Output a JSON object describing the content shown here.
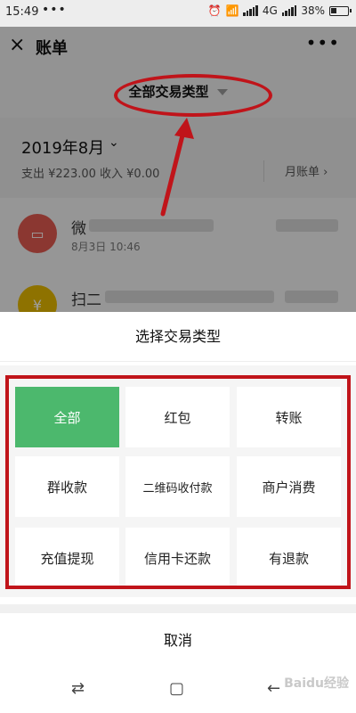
{
  "status_bar": {
    "time": "15:49",
    "dots": "•••",
    "network": "4G",
    "battery": "38%"
  },
  "nav": {
    "close_icon": "×",
    "title": "账单",
    "more_icon": "•••"
  },
  "filter": {
    "label": "全部交易类型"
  },
  "month": {
    "title": "2019年8月",
    "chevron": "⌄",
    "summary": "支出 ¥223.00  收入 ¥0.00",
    "link": "月账单 ›"
  },
  "transactions": [
    {
      "title": "微",
      "date": "8月3日 10:46",
      "icon": "red-packet-icon"
    },
    {
      "title": "扫二",
      "date": "",
      "icon": "money-bag-icon"
    }
  ],
  "sheet": {
    "title": "选择交易类型",
    "options": [
      "全部",
      "红包",
      "转账",
      "群收款",
      "二维码收付款",
      "商户消费",
      "充值提现",
      "信用卡还款",
      "有退款"
    ],
    "selected": "全部",
    "cancel": "取消"
  },
  "annotation_color": "#c0141a",
  "accent_color": "#4cb86d",
  "watermark": "Baidu经验"
}
